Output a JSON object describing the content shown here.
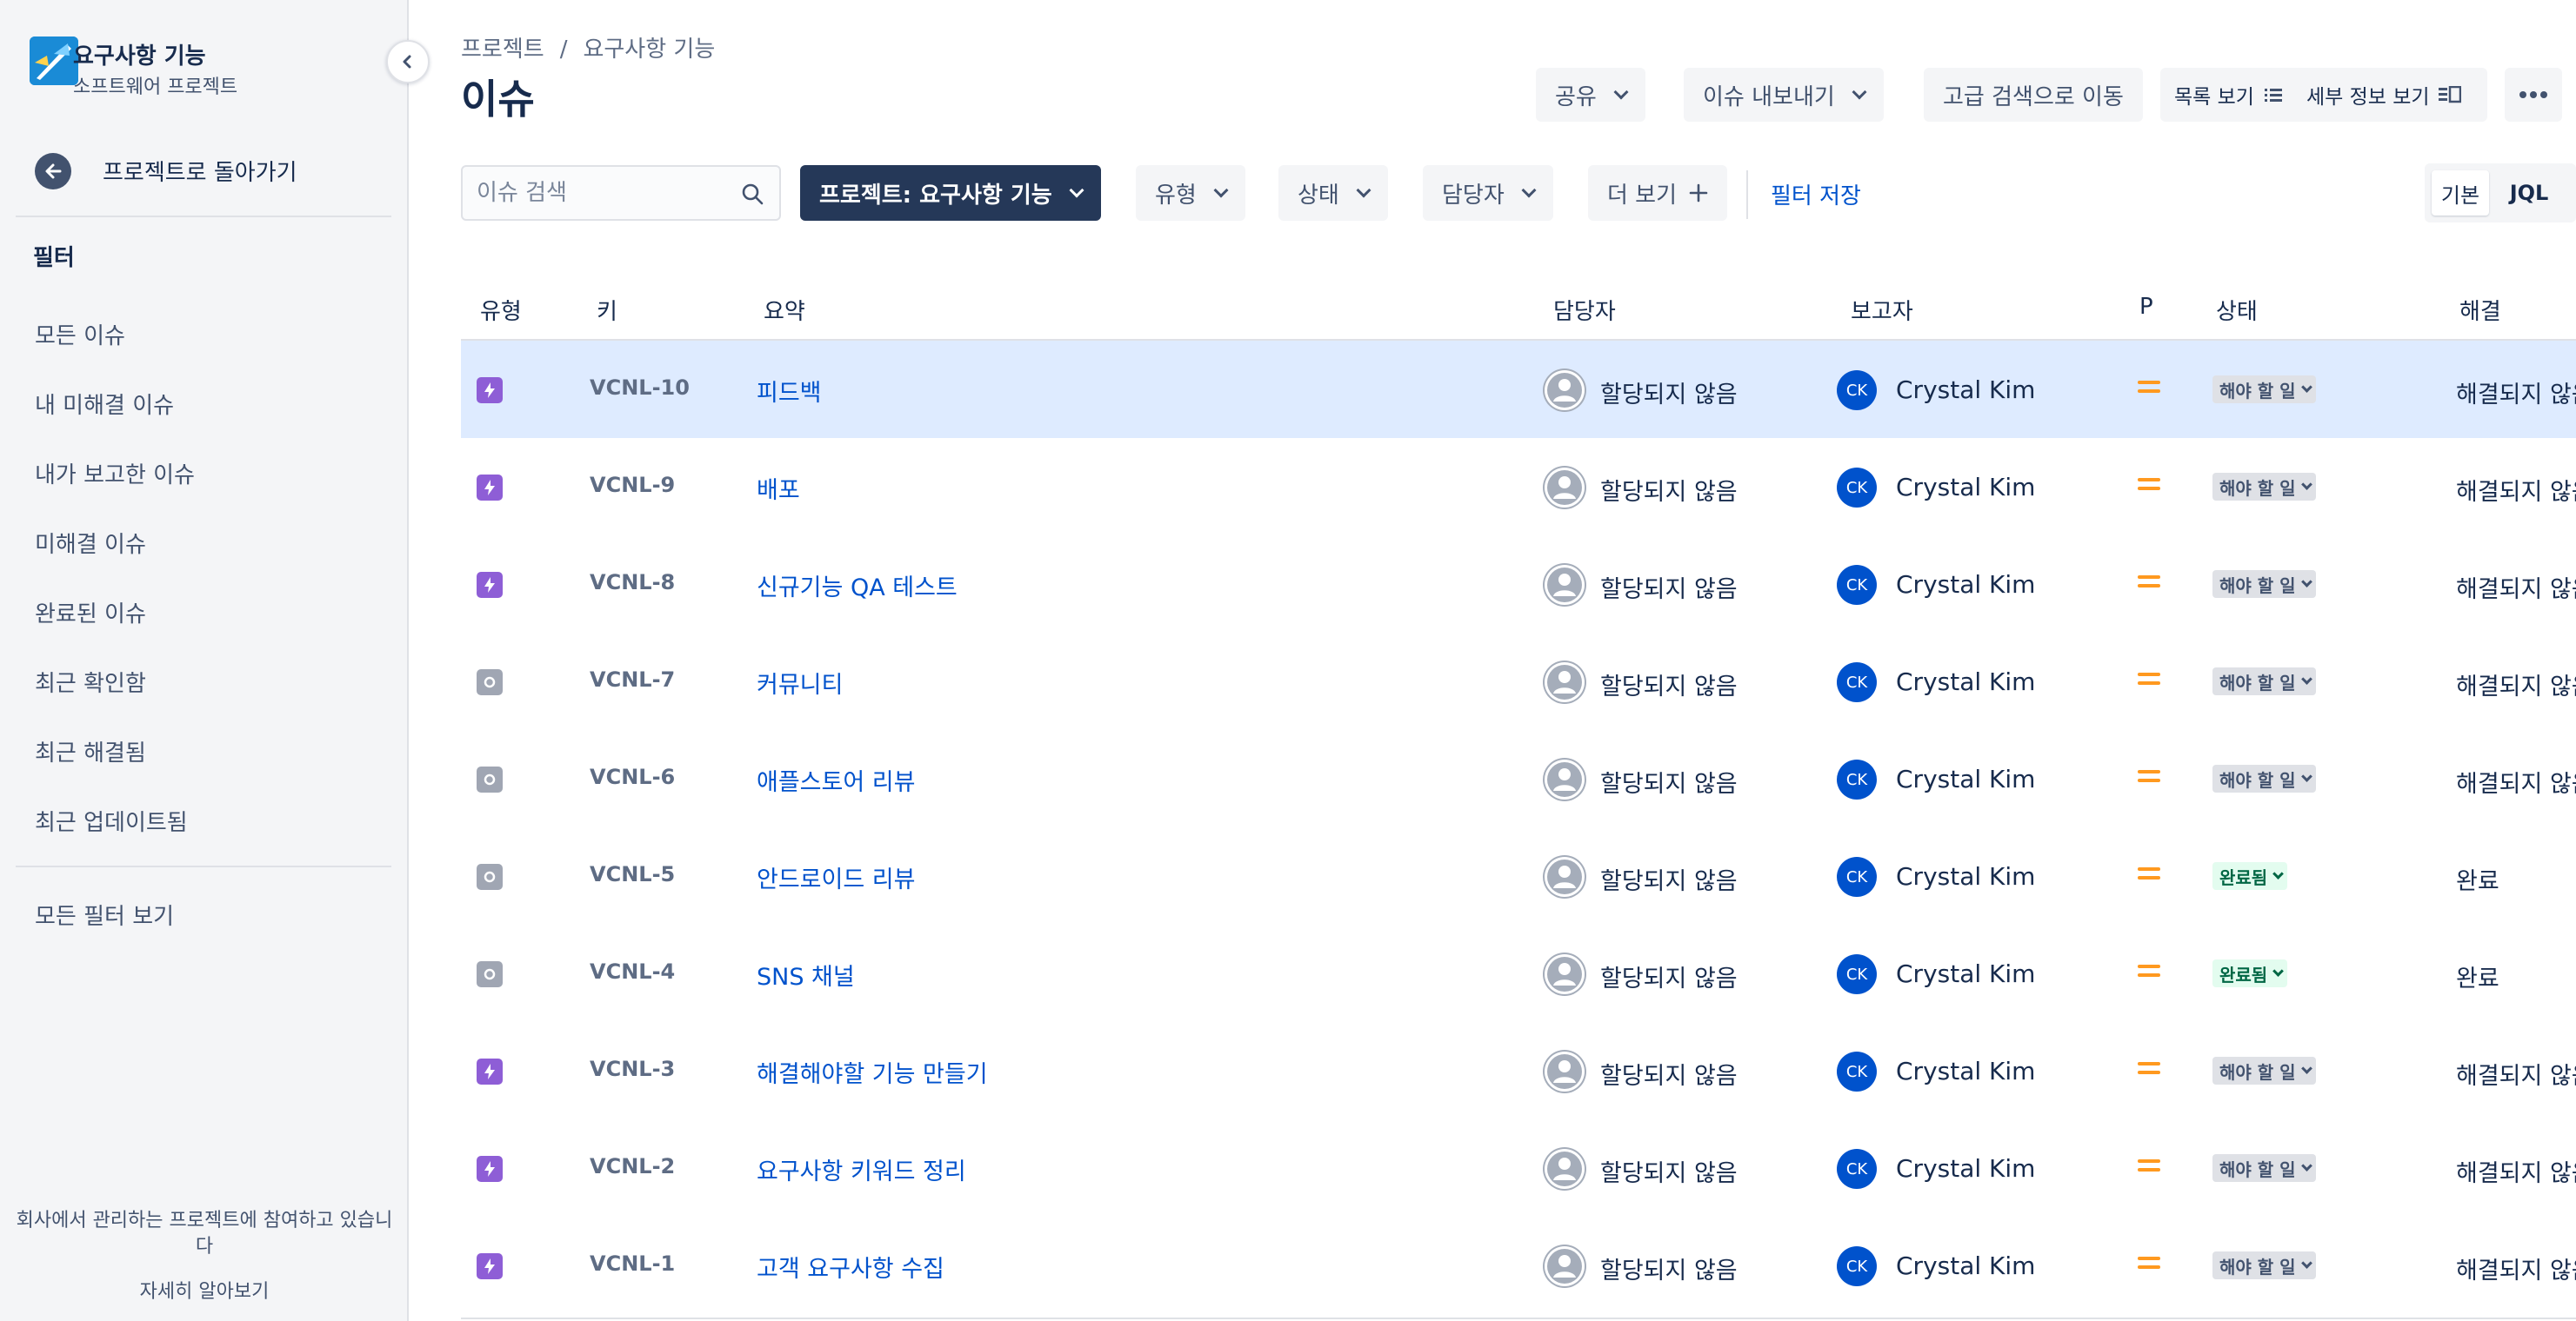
{
  "sidebar": {
    "project_name": "요구사항 기능",
    "project_type": "소프트웨어 프로젝트",
    "back_label": "프로젝트로 돌아가기",
    "section_title": "필터",
    "filters": [
      "모든 이슈",
      "내 미해결 이슈",
      "내가 보고한 이슈",
      "미해결 이슈",
      "완료된 이슈",
      "최근 확인함",
      "최근 해결됨",
      "최근 업데이트됨"
    ],
    "all_filters": "모든 필터 보기",
    "footer_line1": "회사에서 관리하는 프로젝트에 참여하고 있습니",
    "footer_line2": "다",
    "learn_more": "자세히 알아보기"
  },
  "header": {
    "breadcrumb": [
      "프로젝트",
      "요구사항 기능"
    ],
    "breadcrumb_sep": "/",
    "title": "이슈",
    "share": "공유",
    "export": "이슈 내보내기",
    "advanced_search": "고급 검색으로 이동",
    "list_view": "목록 보기",
    "detail_view": "세부 정보 보기"
  },
  "filterbar": {
    "search_placeholder": "이슈 검색",
    "project_filter": "프로젝트: 요구사항 기능",
    "type_filter": "유형",
    "status_filter": "상태",
    "assignee_filter": "담당자",
    "more": "더 보기",
    "save_filter": "필터 저장",
    "mode_basic": "기본",
    "mode_jql": "JQL"
  },
  "table": {
    "columns": [
      "유형",
      "키",
      "요약",
      "담당자",
      "보고자",
      "P",
      "상태",
      "해결"
    ],
    "rows": [
      {
        "type": "story",
        "key": "VCNL-10",
        "summary": "피드백",
        "assignee": "할당되지 않음",
        "reporter_initials": "CK",
        "reporter": "Crystal Kim",
        "status": "해야 할 일",
        "status_kind": "todo",
        "resolution": "해결되지 않음",
        "selected": true
      },
      {
        "type": "story",
        "key": "VCNL-9",
        "summary": "배포",
        "assignee": "할당되지 않음",
        "reporter_initials": "CK",
        "reporter": "Crystal Kim",
        "status": "해야 할 일",
        "status_kind": "todo",
        "resolution": "해결되지 않음"
      },
      {
        "type": "story",
        "key": "VCNL-8",
        "summary": "신규기능 QA 테스트",
        "assignee": "할당되지 않음",
        "reporter_initials": "CK",
        "reporter": "Crystal Kim",
        "status": "해야 할 일",
        "status_kind": "todo",
        "resolution": "해결되지 않음"
      },
      {
        "type": "task",
        "key": "VCNL-7",
        "summary": "커뮤니티",
        "assignee": "할당되지 않음",
        "reporter_initials": "CK",
        "reporter": "Crystal Kim",
        "status": "해야 할 일",
        "status_kind": "todo",
        "resolution": "해결되지 않음"
      },
      {
        "type": "task",
        "key": "VCNL-6",
        "summary": "애플스토어 리뷰",
        "assignee": "할당되지 않음",
        "reporter_initials": "CK",
        "reporter": "Crystal Kim",
        "status": "해야 할 일",
        "status_kind": "todo",
        "resolution": "해결되지 않음"
      },
      {
        "type": "task",
        "key": "VCNL-5",
        "summary": "안드로이드 리뷰",
        "assignee": "할당되지 않음",
        "reporter_initials": "CK",
        "reporter": "Crystal Kim",
        "status": "완료됨",
        "status_kind": "done",
        "resolution": "완료"
      },
      {
        "type": "task",
        "key": "VCNL-4",
        "summary": "SNS 채널",
        "assignee": "할당되지 않음",
        "reporter_initials": "CK",
        "reporter": "Crystal Kim",
        "status": "완료됨",
        "status_kind": "done",
        "resolution": "완료"
      },
      {
        "type": "story",
        "key": "VCNL-3",
        "summary": "해결해야할 기능 만들기",
        "assignee": "할당되지 않음",
        "reporter_initials": "CK",
        "reporter": "Crystal Kim",
        "status": "해야 할 일",
        "status_kind": "todo",
        "resolution": "해결되지 않음"
      },
      {
        "type": "story",
        "key": "VCNL-2",
        "summary": "요구사항 키워드 정리",
        "assignee": "할당되지 않음",
        "reporter_initials": "CK",
        "reporter": "Crystal Kim",
        "status": "해야 할 일",
        "status_kind": "todo",
        "resolution": "해결되지 않음"
      },
      {
        "type": "story",
        "key": "VCNL-1",
        "summary": "고객 요구사항 수집",
        "assignee": "할당되지 않음",
        "reporter_initials": "CK",
        "reporter": "Crystal Kim",
        "status": "해야 할 일",
        "status_kind": "todo",
        "resolution": "해결되지 않음"
      }
    ]
  },
  "colors": {
    "link": "#0052cc",
    "dark_button": "#253858",
    "selected_row": "#deebff",
    "story_icon": "#8e5ed6",
    "task_icon": "#a0a6b3",
    "priority_medium": "#ff991f",
    "avatar": "#0052cc"
  }
}
